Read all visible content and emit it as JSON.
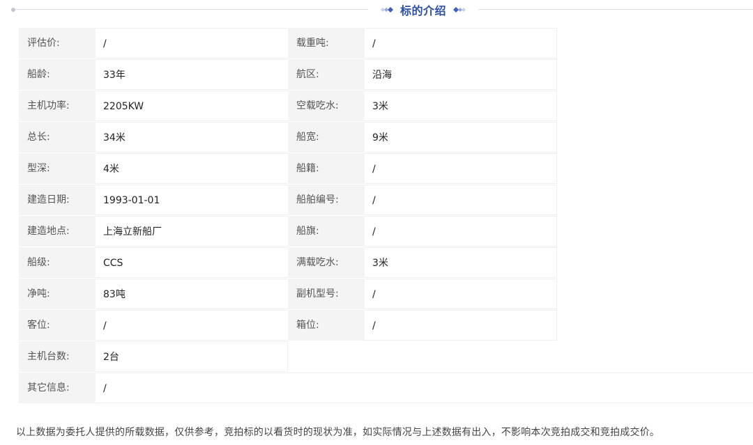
{
  "section": {
    "title": "标的介绍"
  },
  "rows": [
    {
      "l1": "评估价:",
      "v1": "/",
      "l2": "载重吨:",
      "v2": "/"
    },
    {
      "l1": "船龄:",
      "v1": "33年",
      "l2": "航区:",
      "v2": "沿海"
    },
    {
      "l1": "主机功率:",
      "v1": "2205KW",
      "l2": "空载吃水:",
      "v2": "3米"
    },
    {
      "l1": "总长:",
      "v1": "34米",
      "l2": "船宽:",
      "v2": "9米"
    },
    {
      "l1": "型深:",
      "v1": "4米",
      "l2": "船籍:",
      "v2": "/"
    },
    {
      "l1": "建造日期:",
      "v1": "1993-01-01",
      "l2": "船舶编号:",
      "v2": "/"
    },
    {
      "l1": "建造地点:",
      "v1": "上海立新船厂",
      "l2": "船旗:",
      "v2": "/"
    },
    {
      "l1": "船级:",
      "v1": "CCS",
      "l2": "满载吃水:",
      "v2": "3米"
    },
    {
      "l1": "净吨:",
      "v1": "83吨",
      "l2": "副机型号:",
      "v2": "/"
    },
    {
      "l1": "客位:",
      "v1": "/",
      "l2": "箱位:",
      "v2": "/"
    },
    {
      "l1": "主机台数:",
      "v1": "2台"
    },
    {
      "l1": "其它信息:",
      "v1": "/"
    }
  ],
  "disclaimer": "以上数据为委托人提供的所载数据，仅供参考，竞拍标的以看货时的现状为准，如实际情况与上述数据有出入，不影响本次竞拍成交和竞拍成交价。",
  "colors": {
    "accent": "#2c4fa3",
    "label_bg": "#f4f4f5",
    "divider": "#d9dce3"
  }
}
